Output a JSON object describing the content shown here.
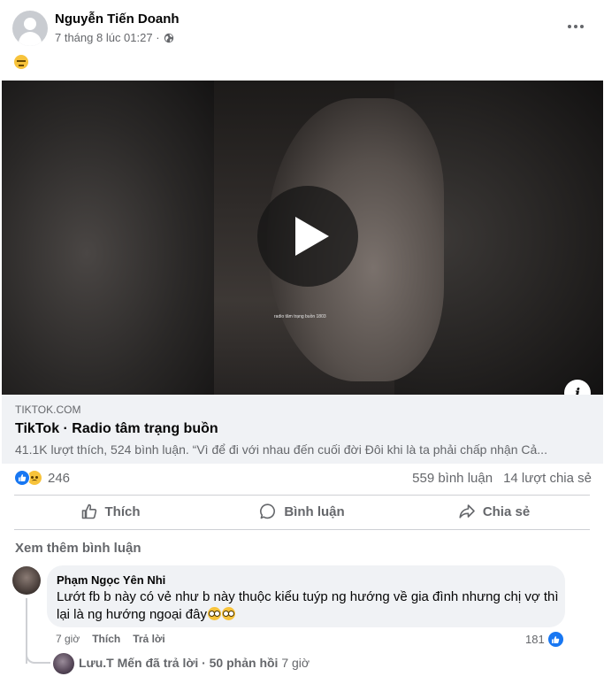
{
  "post": {
    "author": "Nguyễn Tiến Doanh",
    "timestamp": "7 tháng 8 lúc 01:27 ·",
    "privacy_icon": "globe-icon",
    "text_emoji": "expressionless-face-emoji"
  },
  "video": {
    "caption": "radio tâm trạng buồn 1803",
    "info_label": "i"
  },
  "link": {
    "domain": "TIKTOK.COM",
    "title": "TikTok · Radio tâm trạng buồn",
    "description": "41.1K lượt thích, 524 bình luận. “Vì để đi với nhau đến cuối đời Đôi khi là ta phải chấp nhận Cả..."
  },
  "reactions": {
    "types": [
      "like",
      "sad"
    ],
    "count": "246",
    "comments": "559 bình luận",
    "shares": "14 lượt chia sẻ"
  },
  "actions": {
    "like": "Thích",
    "comment": "Bình luận",
    "share": "Chia sẻ"
  },
  "comments_section": {
    "see_more": "Xem thêm bình luận",
    "comment": {
      "name": "Phạm Ngọc Yên Nhi",
      "text": "Lướt fb b này có vẻ như b này thuộc kiểu tuýp ng hướng về gia đình nhưng chị vợ thì lại là ng hướng ngoại đây",
      "time": "7 giờ",
      "like_label": "Thích",
      "reply_label": "Trả lời",
      "like_count": "181"
    },
    "reply_summary": {
      "text": "Lưu.T Mến đã trả lời · 50 phản hồi",
      "time": "7 giờ"
    }
  },
  "colors": {
    "accent": "#1877f2",
    "secondary_text": "#65676b",
    "bubble_bg": "#f0f2f5"
  }
}
